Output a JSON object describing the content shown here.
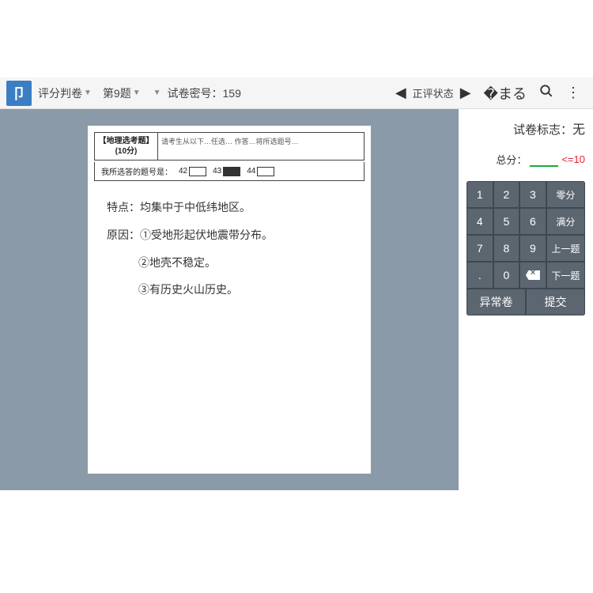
{
  "topbar": {
    "logo": "卩",
    "grading_label": "评分判卷",
    "question_label": "第9题",
    "paper_secret_label": "试卷密号：",
    "paper_secret_value": "159",
    "status_label": "正评状态"
  },
  "paper": {
    "title_line1": "【地理选考题】",
    "title_line2": "(10分)",
    "instructions": "请考生从以下…任选… 作答…将所选题号…",
    "answer_prompt": "我所选答的题号是：",
    "nums": [
      "42",
      "43",
      "44"
    ],
    "handwriting": {
      "l1": "特点：均集中于中低纬地区。",
      "l2": "原因：①受地形起伏地震带分布。",
      "l3": "②地壳不稳定。",
      "l4": "③有历史火山历史。"
    }
  },
  "panel": {
    "mark_label": "试卷标志：",
    "mark_value": "无",
    "total_label": "总分：",
    "limit_text": "<=10"
  },
  "keypad": {
    "k1": "1",
    "k2": "2",
    "k3": "3",
    "zero_full": "零分",
    "k4": "4",
    "k5": "5",
    "k6": "6",
    "full_score": "满分",
    "k7": "7",
    "k8": "8",
    "k9": "9",
    "prev": "上一题",
    "dot": ".",
    "k0": "0",
    "next": "下一题",
    "abnormal": "异常卷",
    "submit": "提交"
  }
}
